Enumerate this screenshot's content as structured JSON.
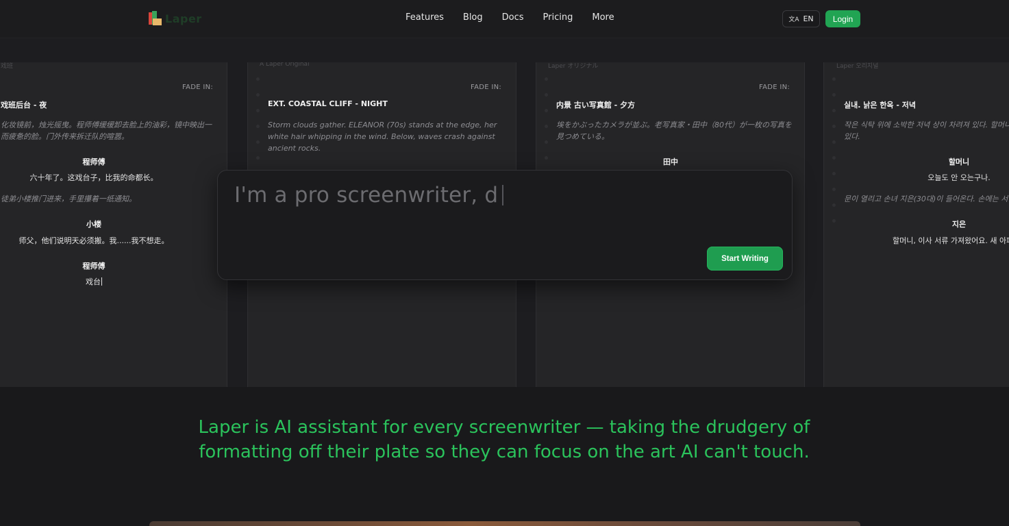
{
  "header": {
    "logo_text": "Laper",
    "nav": [
      "Features",
      "Blog",
      "Docs",
      "Pricing",
      "More"
    ],
    "lang_label": "EN",
    "login_label": "Login"
  },
  "cards": [
    {
      "tag": "戏班",
      "fade_in": "FADE IN:",
      "slug": "戏班后台 - 夜",
      "action1": "化妆镜前，烛光摇曳。程师傅缓缓卸去脸上的油彩，镜中映出一",
      "action1b": "而疲惫的脸。门外传来拆迁队的喧嚣。",
      "char1": "程师傅",
      "dialog1": "六十年了。这戏台子，比我的命都长。",
      "action2": "徒弟小楼推门进来，手里攥着一纸通知。",
      "char2": "小楼",
      "dialog2": "师父，他们说明天必须搬。我......我不想走。",
      "char3": "程师傅",
      "dialog3": "戏台"
    },
    {
      "tag": "A Laper Original",
      "fade_in": "FADE IN:",
      "slug": "EXT. COASTAL CLIFF - NIGHT",
      "action1": "Storm clouds gather. ELEANOR (70s) stands at the edge, her",
      "action1b": "white hair whipping in the wind. Below, waves crash against",
      "action1c": "ancient rocks."
    },
    {
      "tag": "Laper オリジナル",
      "fade_in": "FADE IN:",
      "slug": "内景 古い写真館 - 夕方",
      "action1": "埃をかぶったカメラが並ぶ。老写真家・田中（80代）が一枚の写真を",
      "action1b": "見つめている。",
      "char1": "田中"
    },
    {
      "tag": "Laper 오리지널",
      "slug": "실내. 낡은 한옥 - 저녁",
      "action1": "작은 식탁 위에 소박한 저녁 상이 차려져 있다. 할머니",
      "action1b": "있다.",
      "char1": "할머니",
      "dialog1": "오늘도 안 오는구나.",
      "action2": "문이 열리고 손녀 지은(30대)이 들어온다. 손에는 서",
      "char2": "지은",
      "dialog2": "할머니, 이사 서류 가져왔어요. 새 아파"
    }
  ],
  "prompt": {
    "typed_text": "I'm a pro screenwriter, d",
    "start_label": "Start Writing"
  },
  "tagline": {
    "line1": "Laper is AI assistant for every screenwriter — taking the drudgery of",
    "line2": "formatting off their plate so they can focus on the art AI can't touch."
  },
  "colors": {
    "accent": "#21a453",
    "tagline": "#2bc35c",
    "background": "#19191b"
  }
}
